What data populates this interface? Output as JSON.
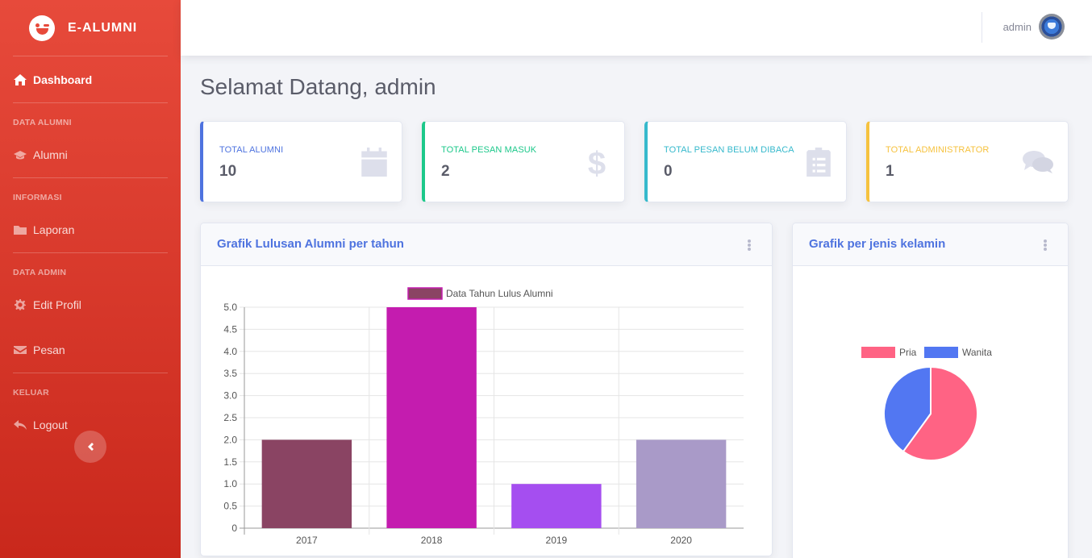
{
  "app": {
    "brand": "E-ALUMNI"
  },
  "sidebar": {
    "dashboard": "Dashboard",
    "sections": [
      {
        "heading": "DATA ALUMNI",
        "items": [
          {
            "label": "Alumni",
            "icon": "graduation-cap-icon"
          }
        ]
      },
      {
        "heading": "INFORMASI",
        "items": [
          {
            "label": "Laporan",
            "icon": "folder-icon"
          }
        ]
      },
      {
        "heading": "DATA ADMIN",
        "items": [
          {
            "label": "Edit Profil",
            "icon": "gear-icon"
          },
          {
            "label": "Pesan",
            "icon": "envelope-icon"
          }
        ]
      },
      {
        "heading": "KELUAR",
        "items": [
          {
            "label": "Logout",
            "icon": "reply-icon"
          }
        ]
      }
    ]
  },
  "topbar": {
    "username": "admin"
  },
  "page": {
    "title": "Selamat Datang, admin"
  },
  "stats": [
    {
      "label": "TOTAL ALUMNI",
      "value": "10",
      "color": "#4e73df",
      "icon": "calendar-icon"
    },
    {
      "label": "TOTAL PESAN MASUK",
      "value": "2",
      "color": "#1cc88a",
      "icon": "dollar-icon"
    },
    {
      "label": "TOTAL PESAN BELUM DIBACA",
      "value": "0",
      "color": "#36b9cc",
      "icon": "clipboard-list-icon"
    },
    {
      "label": "TOTAL ADMINISTRATOR",
      "value": "1",
      "color": "#f6c23e",
      "icon": "comments-icon"
    }
  ],
  "panels": {
    "bar": {
      "title": "Grafik Lulusan Alumni per tahun"
    },
    "pie": {
      "title": "Grafik per jenis kelamin"
    }
  },
  "chart_data": [
    {
      "type": "bar",
      "categories": [
        "2017",
        "2018",
        "2019",
        "2020"
      ],
      "series": [
        {
          "name": "Data Tahun Lulus Alumni",
          "values": [
            2,
            5,
            1,
            2
          ]
        }
      ],
      "bar_colors": [
        "#8a4463",
        "#c41caf",
        "#a54ef0",
        "#a99ac8"
      ],
      "legend_color": "#8a4463",
      "ylim": [
        0,
        5
      ],
      "yticks": [
        "0",
        "0.5",
        "1.0",
        "1.5",
        "2.0",
        "2.5",
        "3.0",
        "3.5",
        "4.0",
        "4.5",
        "5.0"
      ],
      "grid": true,
      "legend": "top-center"
    },
    {
      "type": "pie",
      "categories": [
        "Pria",
        "Wanita"
      ],
      "values": [
        6,
        4
      ],
      "colors": [
        "#ff6384",
        "#5277f2"
      ],
      "legend": "top-center"
    }
  ]
}
